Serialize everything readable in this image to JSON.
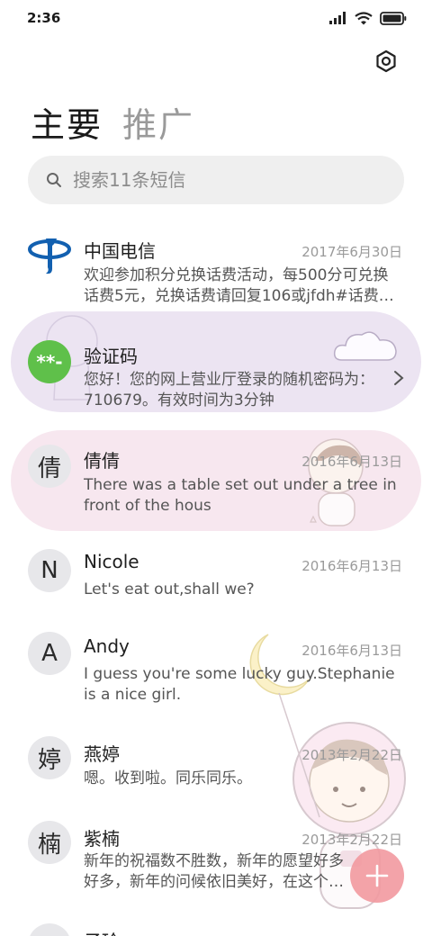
{
  "status": {
    "time": "2:36"
  },
  "tabs": [
    {
      "label": "主要",
      "active": true
    },
    {
      "label": "推广",
      "active": false
    }
  ],
  "search": {
    "placeholder": "搜索11条短信"
  },
  "conversations": [
    {
      "name": "中国电信",
      "date": "2017年6月30日",
      "snippet": "欢迎参加积分兑换话费活动，每500分可兑换话费5元，兑换话费请回复106或jfdh#话费…",
      "avatar": "china-telecom-logo"
    },
    {
      "name": "验证码",
      "date": "",
      "snippet": "您好！您的网上营业厅登录的随机密码为：710679。有效时间为3分钟",
      "avatar": "**-",
      "highlight": "purple"
    },
    {
      "name": "倩倩",
      "date": "2016年6月13日",
      "snippet": "There was a table set out under a tree in front of the hous",
      "avatar": "倩",
      "highlight": "pink"
    },
    {
      "name": "Nicole",
      "date": "2016年6月13日",
      "snippet": "Let's eat out,shall we?",
      "avatar": "N"
    },
    {
      "name": "Andy",
      "date": "2016年6月13日",
      "snippet": "I guess you're some lucky guy.Stephanie is a nice girl.",
      "avatar": "A"
    },
    {
      "name": "燕婷",
      "date": "2013年2月22日",
      "snippet": "嗯。收到啦。同乐同乐。",
      "avatar": "婷"
    },
    {
      "name": "紫楠",
      "date": "2013年2月22日",
      "snippet": "新年的祝福数不胜数，新年的愿望好多好多，新年的问候依旧美好，在这个温馨的时刻",
      "avatar": "楠"
    },
    {
      "name": "子玲",
      "date": "",
      "snippet": "",
      "avatar": ""
    }
  ],
  "colors": {
    "accent": "#f29aa0",
    "verify_green": "#5fc04a",
    "telecom_blue": "#1260b0"
  }
}
